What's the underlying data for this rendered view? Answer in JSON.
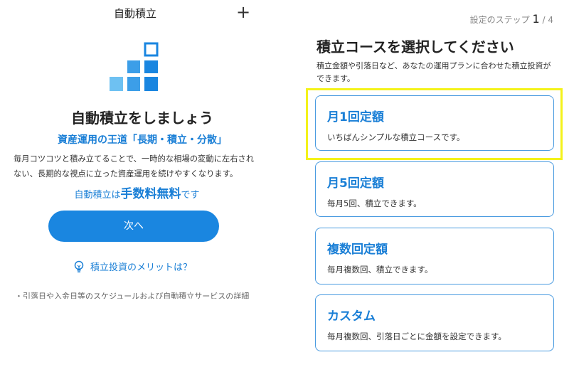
{
  "left_panel": {
    "header": {
      "title": "自動積立",
      "plus_glyph": "+"
    },
    "hero": {
      "title": "自動積立をしましょう",
      "subtitle": "資産運用の王道「長期・積立・分散」",
      "description": "毎月コツコツと積み立てることで、一時的な相場の変動に左右されない、長期的な視点に立った資産運用を続けやすくなります。",
      "fee_prefix": "自動積立は",
      "fee_highlight": "手数料無料",
      "fee_suffix": "です"
    },
    "next_button": "次へ",
    "merit_link": "積立投資のメリットは？",
    "cut_off_note": "・引落日や入金日等のスケジュールおよび自動積立サービスの詳細"
  },
  "right_panel": {
    "step": {
      "label": "設定のステップ",
      "current": "1",
      "total": "/ 4"
    },
    "title": "積立コースを選択してください",
    "description": "積立金額や引落日など、あなたの運用プランに合わせた積立投資ができます。",
    "courses": [
      {
        "title": "月1回定額",
        "desc": "いちばんシンプルな積立コースです。"
      },
      {
        "title": "月5回定額",
        "desc": "毎月5回、積立できます。"
      },
      {
        "title": "複数回定額",
        "desc": "毎月複数回、積立できます。"
      },
      {
        "title": "カスタム",
        "desc": "毎月複数回、引落日ごとに金額を設定できます。"
      }
    ]
  },
  "colors": {
    "accent": "#1a86e0",
    "accent_text": "#1a7fd6",
    "card_border": "#4a9be0",
    "highlight": "#f4f21a"
  },
  "icons": [
    "plus-icon",
    "bar-steps-logo-icon",
    "lightbulb-icon"
  ]
}
